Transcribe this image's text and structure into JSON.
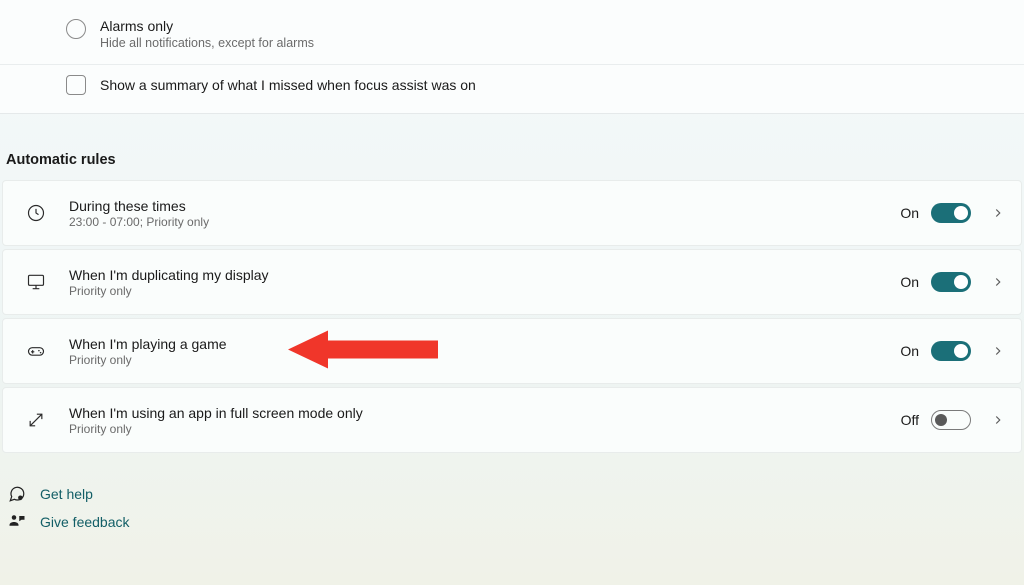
{
  "focus_modes": {
    "alarms_only": {
      "label": "Alarms only",
      "description": "Hide all notifications, except for alarms"
    }
  },
  "summary_checkbox": {
    "label": "Show a summary of what I missed when focus assist was on"
  },
  "section_title": "Automatic rules",
  "rules": [
    {
      "title": "During these times",
      "subtitle": "23:00 - 07:00; Priority only",
      "state": "On",
      "on": true,
      "icon": "clock"
    },
    {
      "title": "When I'm duplicating my display",
      "subtitle": "Priority only",
      "state": "On",
      "on": true,
      "icon": "monitor"
    },
    {
      "title": "When I'm playing a game",
      "subtitle": "Priority only",
      "state": "On",
      "on": true,
      "icon": "gamepad"
    },
    {
      "title": "When I'm using an app in full screen mode only",
      "subtitle": "Priority only",
      "state": "Off",
      "on": false,
      "icon": "fullscreen"
    }
  ],
  "footer": {
    "help": "Get help",
    "feedback": "Give feedback"
  },
  "annotation_target_index": 2
}
